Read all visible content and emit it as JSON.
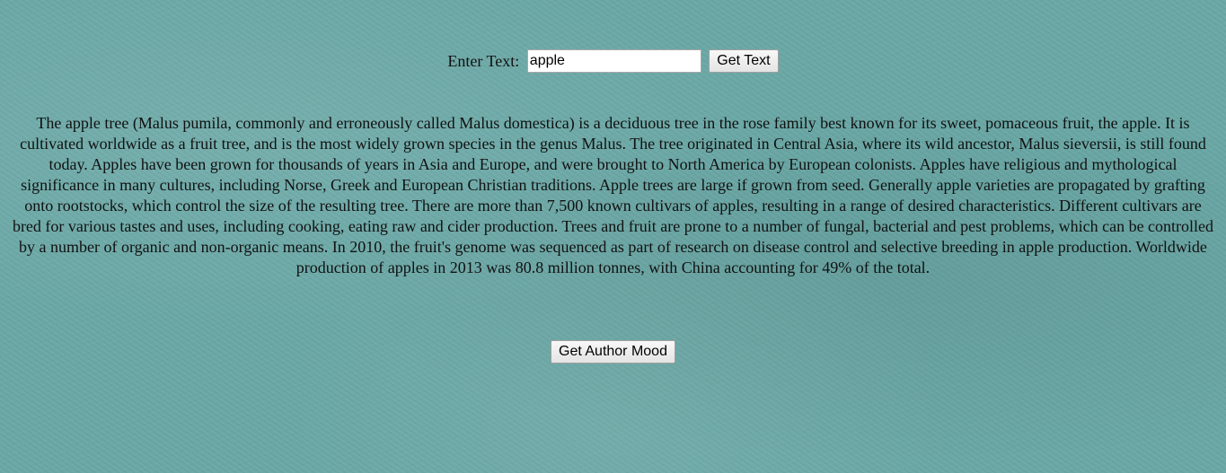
{
  "form": {
    "label": "Enter Text:",
    "input_value": "apple",
    "button_label": "Get Text"
  },
  "content": {
    "paragraph": "The apple tree (Malus pumila, commonly and erroneously called Malus domestica) is a deciduous tree in the rose family best known for its sweet, pomaceous fruit, the apple. It is cultivated worldwide as a fruit tree, and is the most widely grown species in the genus Malus. The tree originated in Central Asia, where its wild ancestor, Malus sieversii, is still found today. Apples have been grown for thousands of years in Asia and Europe, and were brought to North America by European colonists. Apples have religious and mythological significance in many cultures, including Norse, Greek and European Christian traditions. Apple trees are large if grown from seed. Generally apple varieties are propagated by grafting onto rootstocks, which control the size of the resulting tree. There are more than 7,500 known cultivars of apples, resulting in a range of desired characteristics. Different cultivars are bred for various tastes and uses, including cooking, eating raw and cider production. Trees and fruit are prone to a number of fungal, bacterial and pest problems, which can be controlled by a number of organic and non-organic means. In 2010, the fruit's genome was sequenced as part of research on disease control and selective breeding in apple production. Worldwide production of apples in 2013 was 80.8 million tonnes, with China accounting for 49% of the total."
  },
  "actions": {
    "mood_button_label": "Get Author Mood"
  },
  "colors": {
    "background": "#6aa8a6",
    "text": "#111111"
  }
}
